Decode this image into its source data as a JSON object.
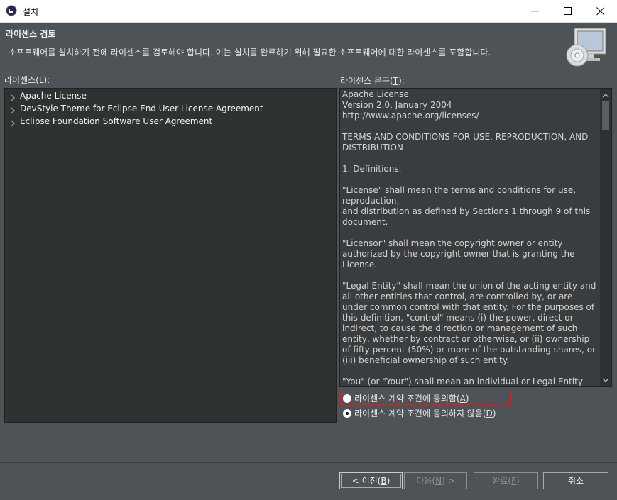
{
  "window": {
    "title": "설치",
    "minimize_icon": "minimize-icon",
    "maximize_icon": "maximize-icon",
    "close_icon": "close-icon"
  },
  "header": {
    "title": "라이센스 검토",
    "description": "소프트웨어를 설치하기 전에 라이센스를 검토해야 합니다. 이는 설치를 완료하기 위해 필요한 소프트웨어에 대한 라이센스를 포함합니다."
  },
  "licenses": {
    "label": "라이센스(",
    "mnemonic": "L",
    "label_end": "):",
    "items": [
      {
        "label": "Apache License"
      },
      {
        "label": "DevStyle Theme for Eclipse End User License Agreement"
      },
      {
        "label": "Eclipse Foundation Software User Agreement"
      }
    ]
  },
  "license_text": {
    "label": "라이센스 문구(",
    "mnemonic": "T",
    "label_end": "):",
    "content": "Apache License\nVersion 2.0, January 2004\nhttp://www.apache.org/licenses/\n\nTERMS AND CONDITIONS FOR USE, REPRODUCTION, AND DISTRIBUTION\n\n1. Definitions.\n\n\"License\" shall mean the terms and conditions for use, reproduction,\nand distribution as defined by Sections 1 through 9 of this document.\n\n\"Licensor\" shall mean the copyright owner or entity authorized by the copyright owner that is granting the License.\n\n\"Legal Entity\" shall mean the union of the acting entity and all other entities that control, are controlled by, or are under common control with that entity. For the purposes of this definition, \"control\" means (i) the power, direct or indirect, to cause the direction or management of such entity, whether by contract or otherwise, or (ii) ownership of fifty percent (50%) or more of the outstanding shares, or (iii) beneficial ownership of such entity.\n\n\"You\" (or \"Your\") shall mean an individual or Legal Entity exercising permissions granted by this License."
  },
  "agreement": {
    "accept": {
      "text": "라이센스 계약 조건에 동의함(",
      "mnemonic": "A",
      "end": ")",
      "checked": false
    },
    "decline": {
      "text": "라이센스 계약 조건에 동의하지 않음(",
      "mnemonic": "D",
      "end": ")",
      "checked": true
    }
  },
  "buttons": {
    "back": {
      "text": "< 이전(",
      "mnemonic": "B",
      "end": ")"
    },
    "next": {
      "text": "다음(",
      "mnemonic": "N",
      "end": ") >"
    },
    "finish": {
      "text": "완료(",
      "mnemonic": "F",
      "end": ")"
    },
    "cancel": {
      "text": "취소"
    }
  },
  "colors": {
    "background": "#4d5356",
    "focus_outline": "#d81e1e"
  }
}
